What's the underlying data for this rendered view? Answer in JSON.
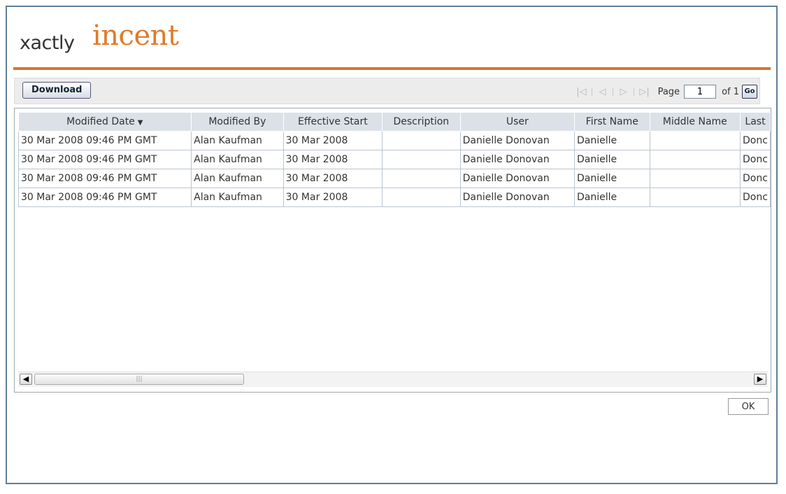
{
  "logo": {
    "part1": "xactly",
    "part2": "incent"
  },
  "toolbar": {
    "download_label": "Download",
    "page_label": "Page",
    "page_value": "1",
    "of_label": "of 1",
    "go_label": "Go"
  },
  "table": {
    "columns": [
      "Modified Date",
      "Modified By",
      "Effective Start",
      "Description",
      "User",
      "First Name",
      "Middle Name",
      "Last"
    ],
    "sort_column": "Modified Date",
    "sort_direction": "descending",
    "rows": [
      [
        "30 Mar 2008 09:46 PM GMT",
        "Alan Kaufman",
        "30 Mar 2008",
        "",
        "Danielle Donovan",
        "Danielle",
        "",
        "Donc"
      ],
      [
        "30 Mar 2008 09:46 PM GMT",
        "Alan Kaufman",
        "30 Mar 2008",
        "",
        "Danielle Donovan",
        "Danielle",
        "",
        "Donc"
      ],
      [
        "30 Mar 2008 09:46 PM GMT",
        "Alan Kaufman",
        "30 Mar 2008",
        "",
        "Danielle Donovan",
        "Danielle",
        "",
        "Donc"
      ],
      [
        "30 Mar 2008 09:46 PM GMT",
        "Alan Kaufman",
        "30 Mar 2008",
        "",
        "Danielle Donovan",
        "Danielle",
        "",
        "Donc"
      ]
    ]
  },
  "footer": {
    "ok_label": "OK"
  },
  "icons": {
    "first": "first-page-icon",
    "prev": "prev-page-icon",
    "next": "next-page-icon",
    "last": "last-page-icon",
    "sort": "sort-desc-icon",
    "scroll_left": "scroll-left-icon",
    "scroll_right": "scroll-right-icon"
  },
  "colors": {
    "brand_orange": "#e07a2a",
    "frame_border": "#5f7f96",
    "header_bg": "#dbe1e7"
  }
}
